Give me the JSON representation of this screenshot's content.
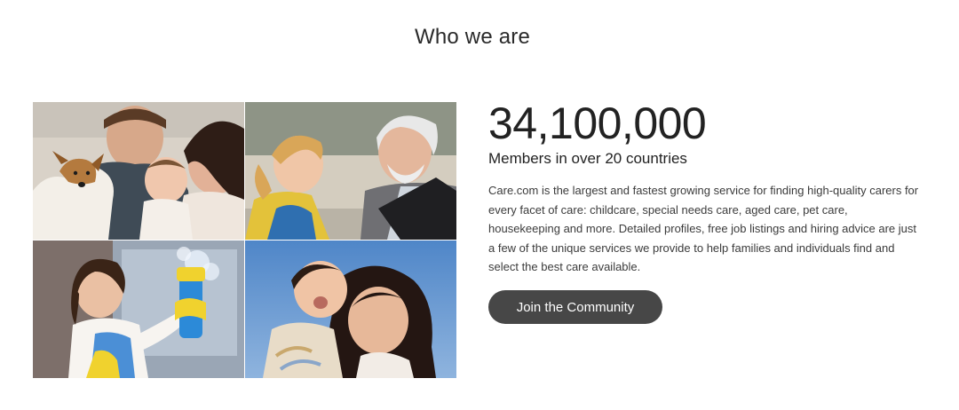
{
  "section": {
    "title": "Who we are"
  },
  "photos": [
    {
      "name": "family-with-dog-photo"
    },
    {
      "name": "grandfather-and-child-photo"
    },
    {
      "name": "housekeeper-cleaning-photo"
    },
    {
      "name": "mother-and-baby-photo"
    }
  ],
  "stats": {
    "members_count": "34,100,000",
    "members_label": "Members in over 20 countries",
    "description": "Care.com is the largest and fastest growing service for finding high-quality carers for every facet of care: childcare, special needs care, aged care, pet care, housekeeping and more. Detailed profiles, free job listings and hiring advice are just a few of the unique services we provide to help families and individuals find and select the best care available."
  },
  "cta": {
    "label": "Join the Community",
    "color": "#474747"
  }
}
